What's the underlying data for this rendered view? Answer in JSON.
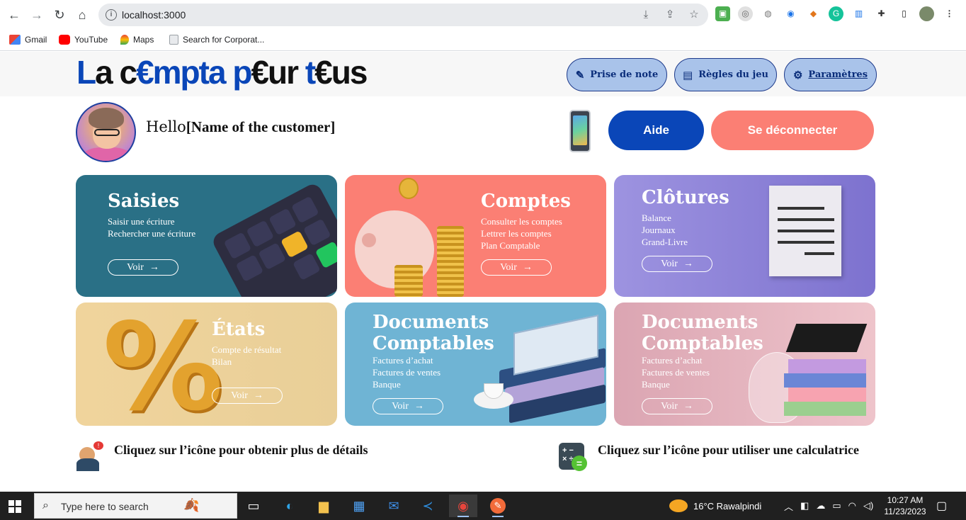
{
  "browser": {
    "url": "localhost:3000",
    "bookmarks": [
      {
        "label": "Gmail",
        "icon": "gmail-icon"
      },
      {
        "label": "YouTube",
        "icon": "youtube-icon"
      },
      {
        "label": "Maps",
        "icon": "maps-icon"
      },
      {
        "label": "Search for Corporat...",
        "icon": "page-icon"
      }
    ]
  },
  "header": {
    "logo": {
      "part1a": "L",
      "part1b": "a c",
      "part1c": "€mpta ",
      "part2a": "p",
      "part2b": "€ur ",
      "part3a": "t",
      "part3b": "€us"
    },
    "buttons": [
      {
        "label": "Prise de note",
        "icon": "pencil-icon"
      },
      {
        "label": "Règles du jeu",
        "icon": "document-icon"
      },
      {
        "label": "Paramètres",
        "icon": "gear-icon"
      }
    ]
  },
  "user": {
    "greeting": "Hello",
    "name": "[Name of the customer]"
  },
  "actions": {
    "help_label": "Aide",
    "logout_label": "Se déconnecter"
  },
  "cards": [
    {
      "title": "Saisies",
      "lines": [
        "Saisir une écriture",
        "Rechercher une écriture"
      ],
      "button": "Voir",
      "color": "#2a7086"
    },
    {
      "title": "Comptes",
      "lines": [
        "Consulter les comptes",
        "Lettrer les comptes",
        "Plan Comptable"
      ],
      "button": "Voir",
      "color": "#fb7f74"
    },
    {
      "title": "Clôtures",
      "lines": [
        "Balance",
        "Journaux",
        "Grand-Livre"
      ],
      "button": "Voir",
      "color": "#8c80d8"
    },
    {
      "title": "États",
      "lines": [
        "Compte de résultat",
        "Bilan"
      ],
      "button": "Voir",
      "color": "#ecd29a"
    },
    {
      "title_line1": "Documents",
      "title_line2": "Comptables",
      "lines": [
        "Factures d’achat",
        "Factures de ventes",
        "Banque"
      ],
      "button": "Voir",
      "color": "#6fb4d4"
    },
    {
      "title_line1": "Documents",
      "title_line2": "Comptables",
      "lines": [
        "Factures d’achat",
        "Factures de ventes",
        "Banque"
      ],
      "button": "Voir",
      "color": "#e6b5bf"
    }
  ],
  "hints": {
    "details": "Cliquez sur l’icône pour obtenir plus de détails",
    "calculator": "Cliquez sur l’icône pour utiliser une calculatrice"
  },
  "taskbar": {
    "search_placeholder": "Type here to search",
    "weather": "16°C  Rawalpindi",
    "time": "10:27 AM",
    "date": "11/23/2023"
  }
}
